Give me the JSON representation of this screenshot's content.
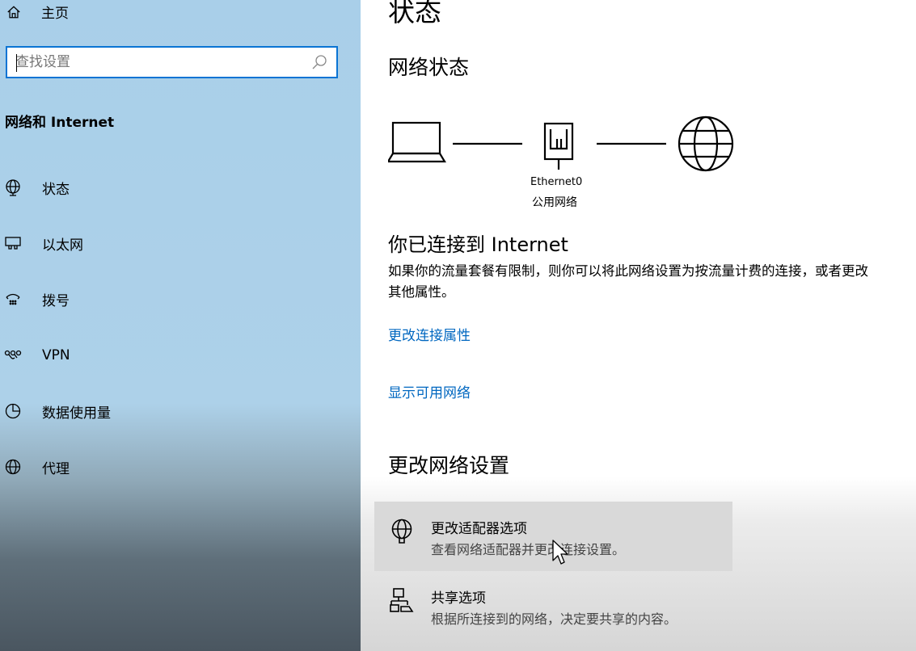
{
  "sidebar": {
    "home_label": "主页",
    "search": {
      "placeholder": "查找设置"
    },
    "section_title": "网络和 Internet",
    "items": [
      {
        "label": "状态",
        "icon": "status-globe-icon"
      },
      {
        "label": "以太网",
        "icon": "ethernet-icon"
      },
      {
        "label": "拨号",
        "icon": "dialup-icon"
      },
      {
        "label": "VPN",
        "icon": "vpn-icon"
      },
      {
        "label": "数据使用量",
        "icon": "data-usage-icon"
      },
      {
        "label": "代理",
        "icon": "globe-icon"
      }
    ]
  },
  "main": {
    "title": "状态",
    "network_status_heading": "网络状态",
    "adapter": {
      "name": "Ethernet0",
      "type": "公用网络"
    },
    "connected_title": "你已连接到 Internet",
    "connected_desc": "如果你的流量套餐有限制，则你可以将此网络设置为按流量计费的连接，或者更改其他属性。",
    "link_change_properties": "更改连接属性",
    "link_show_networks": "显示可用网络",
    "change_settings_heading": "更改网络设置",
    "options": [
      {
        "title": "更改适配器选项",
        "desc": "查看网络适配器并更改连接设置。",
        "icon": "adapter-globe-icon"
      },
      {
        "title": "共享选项",
        "desc": "根据所连接到的网络，决定要共享的内容。",
        "icon": "sharing-icon"
      }
    ]
  },
  "colors": {
    "accent": "#0a74d4",
    "link": "#0067c0",
    "sidebar": "#add1e9"
  }
}
